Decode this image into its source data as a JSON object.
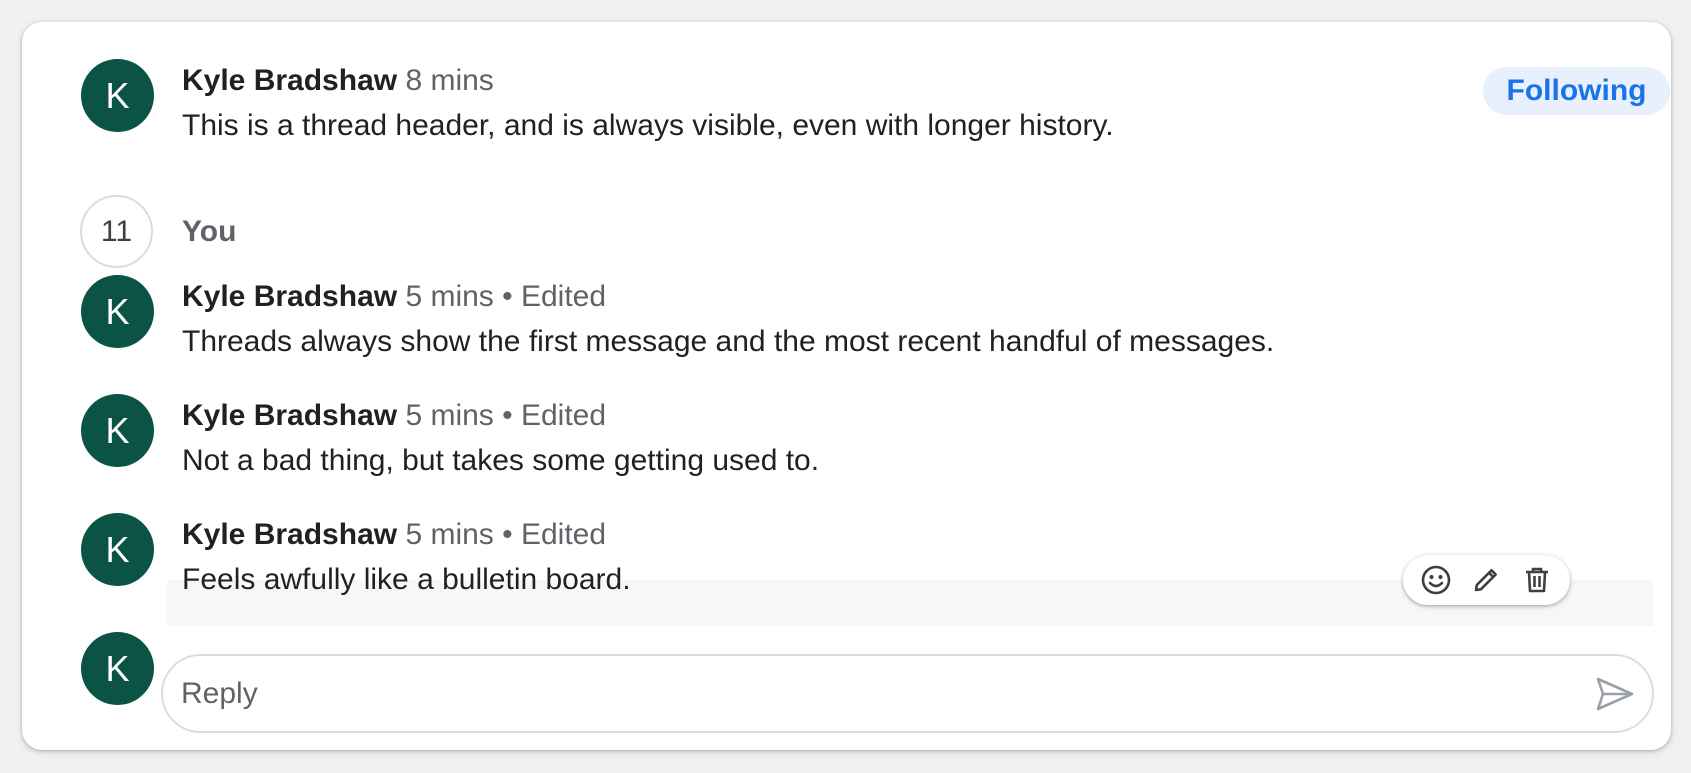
{
  "thread": {
    "following_label": "Following",
    "header": {
      "avatar_initial": "K",
      "author": "Kyle Bradshaw",
      "time": "8 mins",
      "text": "This is a thread header, and is always visible, even with longer history."
    },
    "collapsed": {
      "count": "11",
      "label": "You"
    },
    "messages": [
      {
        "avatar_initial": "K",
        "author": "Kyle Bradshaw",
        "time": "5 mins",
        "edited": "• Edited",
        "text": "Threads always show the first message and the most recent handful of messages."
      },
      {
        "avatar_initial": "K",
        "author": "Kyle Bradshaw",
        "time": "5 mins",
        "edited": "• Edited",
        "text": "Not a bad thing, but takes some getting used to."
      },
      {
        "avatar_initial": "K",
        "author": "Kyle Bradshaw",
        "time": "5 mins",
        "edited": "• Edited",
        "text": "Feels awfully like a bulletin board."
      }
    ],
    "message_actions": [
      "emoji-icon",
      "pencil-icon",
      "trash-icon"
    ],
    "reply": {
      "avatar_initial": "K",
      "placeholder": "Reply",
      "send_icon": "send-icon"
    }
  },
  "colors": {
    "avatar_bg": "#0b5345",
    "following_bg": "#e8f0fe",
    "following_text": "#1a73e8",
    "hover_bg": "#f6f7f9"
  }
}
